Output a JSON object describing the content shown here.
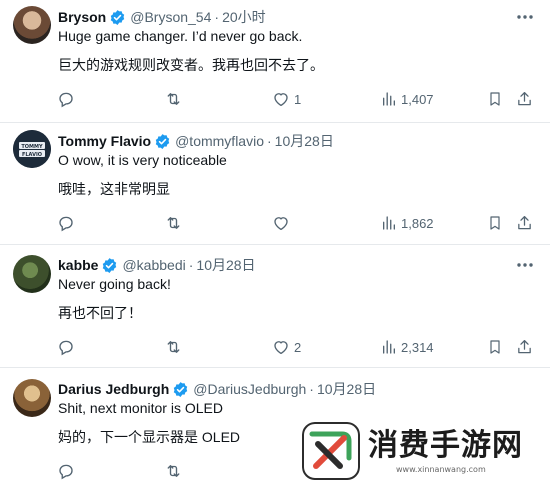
{
  "tweets": [
    {
      "name": "Bryson",
      "handle": "@Bryson_54",
      "time": "20小时",
      "text": "Huge game changer. I’d never go back.",
      "translation": "巨大的游戏规则改变者。我再也回不去了。",
      "likes": "1",
      "views": "1,407",
      "avatar_color": "#8a6a52"
    },
    {
      "name": "Tommy Flavio",
      "handle": "@tommyflavio",
      "time": "10月28日",
      "text": "O wow, it is very noticeable",
      "translation": "哦哇，这非常明显",
      "likes": "",
      "views": "1,862",
      "avatar_color": "#1d2b3a",
      "avatar_text": "TOMMY FLAVIO"
    },
    {
      "name": "kabbe",
      "handle": "@kabbedi",
      "time": "10月28日",
      "text": "Never going back!",
      "translation": "再也不回了！",
      "likes": "2",
      "views": "2,314",
      "avatar_color": "#3d4f2c"
    },
    {
      "name": "Darius Jedburgh",
      "handle": "@DariusJedburgh",
      "time": "10月28日",
      "text": "Shit, next monitor is OLED",
      "translation": "妈的，下一个显示器是 OLED",
      "avatar_color": "#7a5a3a"
    }
  ],
  "dot": "·",
  "watermark": {
    "title": "消费手游网",
    "url": "www.xinnanwang.com",
    "logo_color": "#3da35a"
  },
  "colors": {
    "verified": "#1d9bf0",
    "icon": "#536471",
    "text": "#0f1419",
    "divider": "#e6e9ec"
  }
}
